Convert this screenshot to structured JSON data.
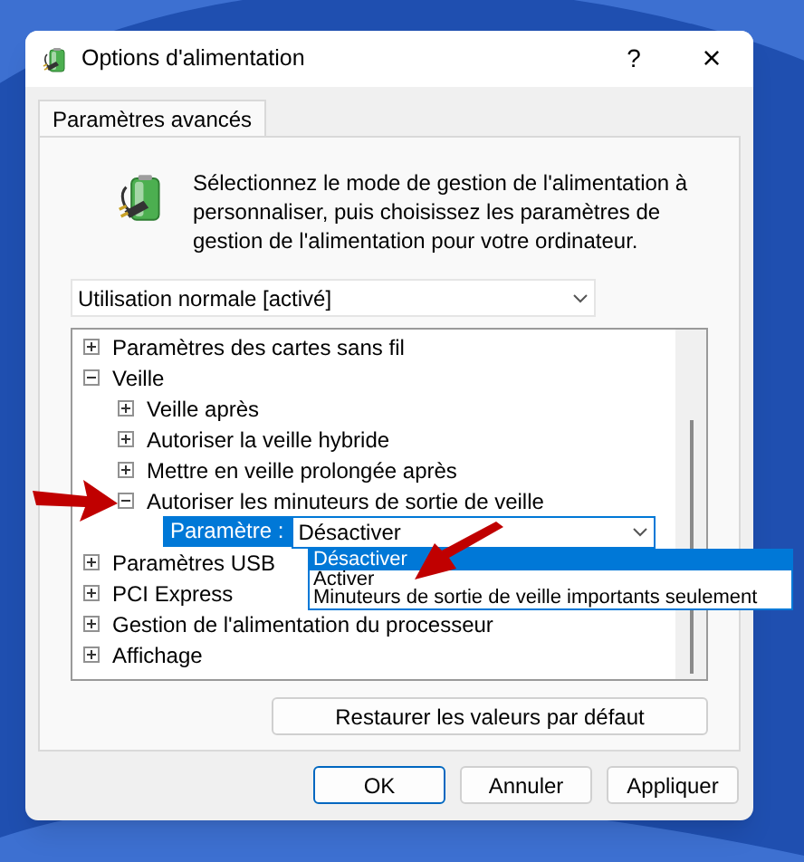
{
  "window": {
    "title": "Options d'alimentation",
    "help": "?",
    "close": "×"
  },
  "tabs": [
    {
      "label": "Paramètres avancés",
      "selected": true
    }
  ],
  "intro": "Sélectionnez le mode de gestion de l'alimentation à personnaliser, puis choisissez les paramètres de gestion de l'alimentation pour votre ordinateur.",
  "plan": {
    "value": "Utilisation normale [activé]"
  },
  "tree": [
    {
      "kind": "group",
      "label": "Paramètres des cartes sans fil",
      "expanded": false
    },
    {
      "kind": "group",
      "label": "Veille",
      "expanded": true,
      "children": [
        {
          "kind": "group",
          "label": "Veille après",
          "expanded": false
        },
        {
          "kind": "group",
          "label": "Autoriser la veille hybride",
          "expanded": false
        },
        {
          "kind": "group",
          "label": "Mettre en veille prolongée après",
          "expanded": false
        },
        {
          "kind": "group",
          "label": "Autoriser les minuteurs de sortie de veille",
          "expanded": true,
          "children": [
            {
              "kind": "setting",
              "label": "Paramètre :",
              "value": "Désactiver",
              "open": true,
              "options": [
                {
                  "label": "Désactiver",
                  "selected": true
                },
                {
                  "label": "Activer",
                  "selected": false
                },
                {
                  "label": "Minuteurs de sortie de veille importants seulement",
                  "selected": false
                }
              ]
            }
          ]
        }
      ]
    },
    {
      "kind": "group",
      "label": "Paramètres USB",
      "expanded": false
    },
    {
      "kind": "group",
      "label": "PCI Express",
      "expanded": false
    },
    {
      "kind": "group",
      "label": "Gestion de l'alimentation du processeur",
      "expanded": false
    },
    {
      "kind": "group",
      "label": "Affichage",
      "expanded": false
    }
  ],
  "restore_button": "Restaurer les valeurs par défaut",
  "buttons": [
    {
      "label": "OK",
      "default": true
    },
    {
      "label": "Annuler",
      "default": false
    },
    {
      "label": "Appliquer",
      "default": false
    }
  ]
}
